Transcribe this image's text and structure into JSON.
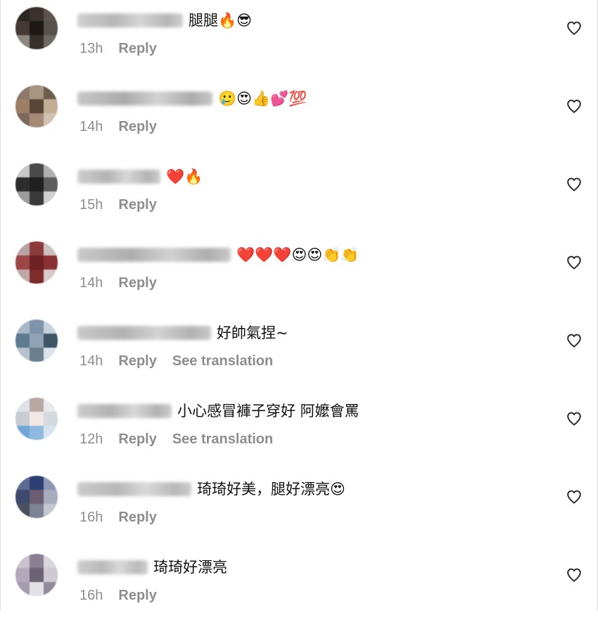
{
  "comments": [
    {
      "text": "腿腿🔥😎",
      "time": "13h",
      "reply_label": "Reply",
      "avatar_colors": [
        "#2b2523",
        "#3a302d",
        "#5c5250",
        "#463a36",
        "#1d1715",
        "#57514b",
        "#8d8681",
        "#36302c",
        "#6f6964"
      ],
      "username_blur": [
        "#bfbfbf",
        "#9e9e9e",
        "#c7c7c7"
      ]
    },
    {
      "text": "🥲😍👍💕💯",
      "time": "14h",
      "reply_label": "Reply",
      "avatar_colors": [
        "#8b7a6c",
        "#a99482",
        "#6e5c4d",
        "#9c7f66",
        "#5a4434",
        "#c4ad95",
        "#7b6a5c",
        "#a58b75",
        "#d2c2b3"
      ],
      "username_blur": [
        "#b5b5b5",
        "#8f8f8f",
        "#c4c4c4"
      ]
    },
    {
      "text": "❤️🔥",
      "time": "15h",
      "reply_label": "Reply",
      "avatar_colors": [
        "#c8c8c8",
        "#4a4a4a",
        "#b0b0b0",
        "#2d2d2d",
        "#1f1f1f",
        "#5d5d5d",
        "#9c9c9c",
        "#3a3a3a",
        "#d1d1d1"
      ],
      "username_blur": [
        "#bdbdbd",
        "#9b9b9b",
        "#c9c9c9"
      ]
    },
    {
      "text": "❤️❤️❤️😍😍👏👏",
      "time": "14h",
      "reply_label": "Reply",
      "avatar_colors": [
        "#b9a2a2",
        "#8c3a3a",
        "#cfc0c0",
        "#9c4646",
        "#6f2020",
        "#8a3232",
        "#c0a8a8",
        "#7d2b2b",
        "#d8caca"
      ],
      "username_blur": [
        "#b8b8b8",
        "#939393",
        "#c2c2c2"
      ]
    },
    {
      "text": "好帥氣捏~",
      "time": "14h",
      "reply_label": "Reply",
      "translate_label": "See translation",
      "avatar_colors": [
        "#a9b8c8",
        "#7e94ab",
        "#c7d2dd",
        "#5d7a8f",
        "#8fa3b6",
        "#3e5566",
        "#b7c2cc",
        "#6b7e8d",
        "#dce3ea"
      ],
      "username_blur": [
        "#b7b7b7",
        "#999999",
        "#c5c5c5"
      ]
    },
    {
      "text": "小心感冒褲子穿好 阿嬤會罵",
      "time": "12h",
      "reply_label": "Reply",
      "translate_label": "See translation",
      "avatar_colors": [
        "#dfe2e6",
        "#b8a8a4",
        "#e8eaed",
        "#c9cdd3",
        "#f2e8e6",
        "#d4d9df",
        "#6fa6d6",
        "#8fb9df",
        "#d7e4ef"
      ],
      "username_blur": [
        "#bcbcbc",
        "#9a9a9a",
        "#cacaca"
      ]
    },
    {
      "text": "琦琦好美，腿好漂亮😍",
      "time": "16h",
      "reply_label": "Reply",
      "avatar_colors": [
        "#5b6a94",
        "#2e3f73",
        "#8e97b2",
        "#3d4a6e",
        "#6b5e72",
        "#a7acbe",
        "#4b4f5e",
        "#7d8296",
        "#c4c7d1"
      ],
      "username_blur": [
        "#bababa",
        "#a0a0a0",
        "#cccccc"
      ]
    },
    {
      "text": "琦琦好漂亮",
      "time": "16h",
      "reply_label": "Reply",
      "avatar_colors": [
        "#c7c2cd",
        "#8a7f93",
        "#d9d5de",
        "#b3a9bb",
        "#6c6275",
        "#cfc9d4",
        "#a59cad",
        "#e3e0e6",
        "#938a9b"
      ],
      "username_blur": [
        "#bdbdbd",
        "#a3a3a3",
        "#cccccc"
      ]
    }
  ],
  "colors": {
    "meta_text": "#8e8e8e",
    "comment_text": "#111111",
    "heart_stroke": "#262626"
  },
  "icons": {
    "like": "heart-outline-icon"
  }
}
